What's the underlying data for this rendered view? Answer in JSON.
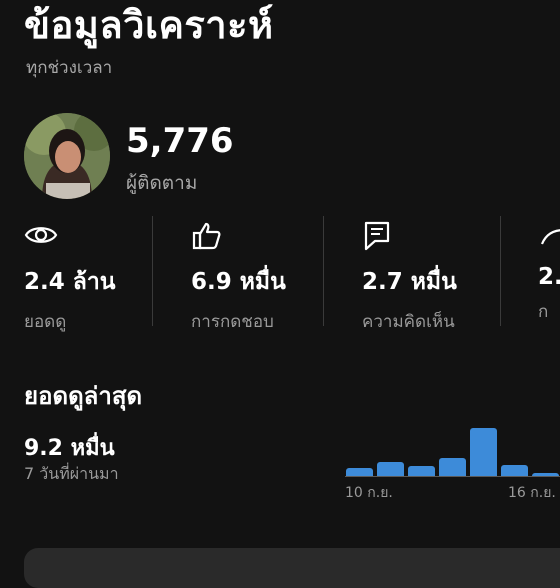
{
  "header": {
    "title": "ข้อมูลวิเคราะห์",
    "subtitle": "ทุกช่วงเวลา"
  },
  "channel": {
    "subscribers": "5,776",
    "subscribers_label": "ผู้ติดตาม"
  },
  "stats": [
    {
      "icon": "eye-icon",
      "value": "2.4 ล้าน",
      "label": "ยอดดู"
    },
    {
      "icon": "thumbs-up-icon",
      "value": "6.9 หมื่น",
      "label": "การกดชอบ"
    },
    {
      "icon": "comment-icon",
      "value": "2.7 หมื่น",
      "label": "ความคิดเห็น"
    },
    {
      "icon": "share-icon",
      "value": "2.",
      "label": "ก"
    }
  ],
  "recent": {
    "title": "ยอดดูล่าสุด",
    "value": "9.2 หมื่น",
    "period": "7 วันที่ผ่านมา"
  },
  "chart_data": {
    "type": "bar",
    "values": [
      8,
      14,
      10,
      18,
      49,
      11,
      3
    ],
    "tick_labels": [
      "10 ก.ย.",
      "16 ก.ย."
    ],
    "ylim": [
      0,
      50
    ]
  },
  "colors": {
    "background": "#121212",
    "bar": "#3d8bd9",
    "muted_text": "#a8a8a8"
  }
}
